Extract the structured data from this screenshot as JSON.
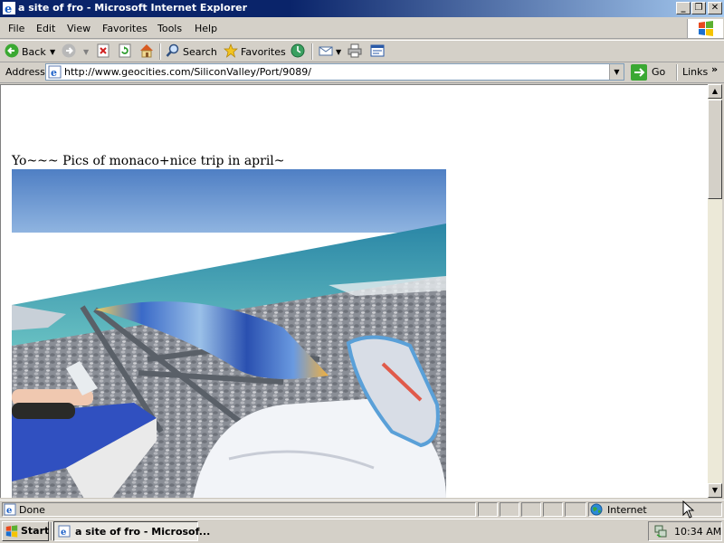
{
  "window": {
    "title": "a site of fro - Microsoft Internet Explorer",
    "minimize_glyph": "_",
    "maximize_glyph": "❐",
    "close_glyph": "✕"
  },
  "menu": {
    "items": [
      {
        "label": "File"
      },
      {
        "label": "Edit"
      },
      {
        "label": "View"
      },
      {
        "label": "Favorites"
      },
      {
        "label": "Tools"
      },
      {
        "label": "Help"
      }
    ]
  },
  "toolbar": {
    "back_label": "Back",
    "search_label": "Search",
    "favorites_label": "Favorites"
  },
  "address": {
    "label": "Address",
    "url": "http://www.geocities.com/SiliconValley/Port/9089/",
    "go_label": "Go",
    "links_label": "Links"
  },
  "page": {
    "text": "Yo~~~ Pics of monaco+nice trip in april~"
  },
  "status": {
    "text": "Done",
    "zone": "Internet"
  },
  "taskbar": {
    "start_label": "Start",
    "task_label": "a site of fro - Microsof...",
    "clock": "10:34 AM"
  },
  "colors": {
    "titlebar": "#0a246a",
    "chrome": "#d4d0c8",
    "sky": "#5b88c8",
    "sea": "#2f9aa8"
  }
}
